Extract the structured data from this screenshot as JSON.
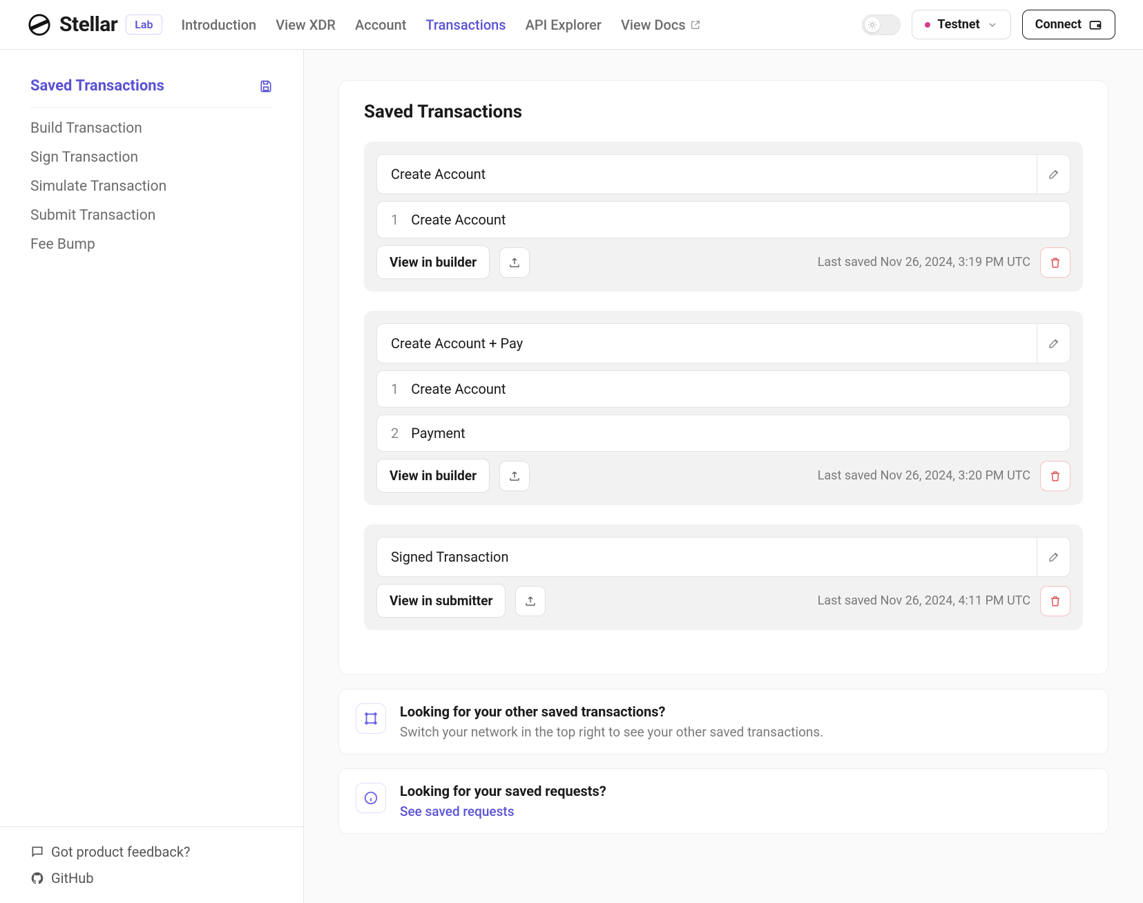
{
  "brand": {
    "name": "Stellar",
    "badge": "Lab"
  },
  "nav": {
    "items": [
      {
        "label": "Introduction",
        "active": false
      },
      {
        "label": "View XDR",
        "active": false
      },
      {
        "label": "Account",
        "active": false
      },
      {
        "label": "Transactions",
        "active": true
      },
      {
        "label": "API Explorer",
        "active": false
      },
      {
        "label": "View Docs",
        "active": false,
        "external": true
      }
    ]
  },
  "header": {
    "network": "Testnet",
    "connect": "Connect"
  },
  "sidebar": {
    "title": "Saved Transactions",
    "links": [
      {
        "label": "Build Transaction"
      },
      {
        "label": "Sign Transaction"
      },
      {
        "label": "Simulate Transaction"
      },
      {
        "label": "Submit Transaction"
      },
      {
        "label": "Fee Bump"
      }
    ],
    "footer_feedback": "Got product feedback?",
    "footer_github": "GitHub"
  },
  "page": {
    "title": "Saved Transactions"
  },
  "transactions": [
    {
      "name": "Create Account",
      "ops": [
        {
          "n": "1",
          "label": "Create Account"
        }
      ],
      "action": "View in builder",
      "timestamp": "Last saved Nov 26, 2024, 3:19 PM UTC"
    },
    {
      "name": "Create Account + Pay",
      "ops": [
        {
          "n": "1",
          "label": "Create Account"
        },
        {
          "n": "2",
          "label": "Payment"
        }
      ],
      "action": "View in builder",
      "timestamp": "Last saved Nov 26, 2024, 3:20 PM UTC"
    },
    {
      "name": "Signed Transaction",
      "ops": [],
      "action": "View in submitter",
      "timestamp": "Last saved Nov 26, 2024, 4:11 PM UTC"
    }
  ],
  "info_panels": {
    "other_saved": {
      "title": "Looking for your other saved transactions?",
      "text": "Switch your network in the top right to see your other saved transactions."
    },
    "saved_requests": {
      "title": "Looking for your saved requests?",
      "link": "See saved requests"
    }
  }
}
